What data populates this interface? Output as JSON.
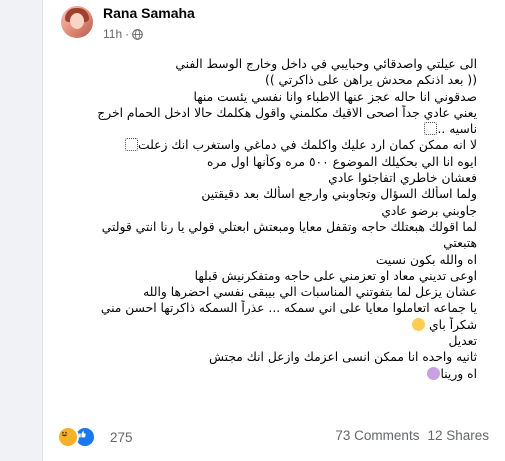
{
  "post": {
    "author": "Rana Samaha",
    "time": "11h",
    "separator": "·",
    "audience_icon": "globe-icon",
    "lines": [
      "الى عيلتي واصدقائي وحبايبي في داخل وخارج الوسط الفني",
      "(( بعد اذنكم محدش يراهن على ذاكرتي ))",
      "صدقوني انا حاله عجز عنها الاطباء وانا نفسي يئست منها",
      "يعني عادي جداً اصحى الاقيك مكلمني واقول هكلمك حالا ادخل الحمام اخرج",
      "ناسيه ..",
      "لا انه ممكن كمان ارد عليك واكلمك في دماغي واستغرب انك زعلت",
      "ايوه انا الي بحكيلك الموضوع ٥٠٠ مره وكأنها اول مره",
      "فعشان خاطري اتفاجئوا عادي",
      "ولما اسألك السؤال وتجاوبني وارجع اسألك بعد دقيقتين",
      "جاوبني برضو عادي",
      "لما اقولك هبعتلك حاجه وتقفل معايا ومبعتش ابعتلي قولي يا رنا انتي قولتي",
      "هتبعتي",
      "اه والله بكون نسيت",
      "اوعى تديني معاد او تعزمني على حاجه ومتفكرنيش قبلها",
      "عشان يزعل لما بتفوتني المناسبات الي بيبقى نفسي احضرها والله",
      "يا جماعه اتعاملوا معايا على اني سمكه ... عذراً السمكه ذاكرتها احسن مني",
      "شكراً باي",
      "تعديل",
      "ثانيه واحده انا ممكن انسى اعزمك وازعل انك مجتش",
      "اه ورينا"
    ],
    "reaction_count": "275",
    "comments": "73 Comments",
    "shares": "12 Shares"
  },
  "colors": {
    "text": "#050505",
    "secondary": "#65676b",
    "like": "#1877f2",
    "haha": "#f7b125"
  }
}
